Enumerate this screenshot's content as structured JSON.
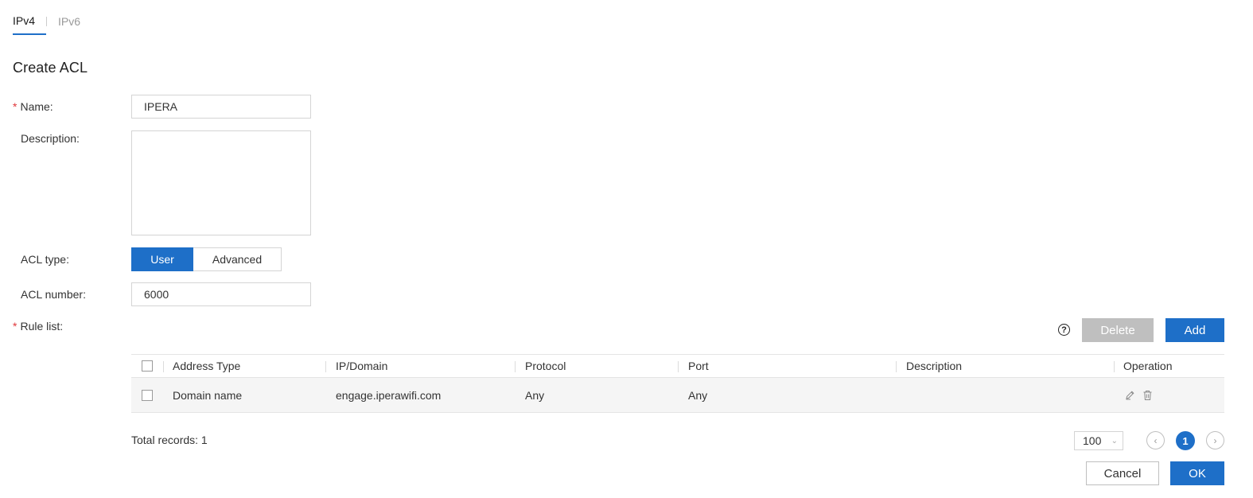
{
  "tabs": [
    {
      "label": "IPv4",
      "active": true
    },
    {
      "label": "IPv6",
      "active": false
    }
  ],
  "page_title": "Create ACL",
  "form": {
    "name_label": "Name:",
    "name_value": "IPERA",
    "description_label": "Description:",
    "description_value": "",
    "acl_type_label": "ACL type:",
    "acl_type_options": [
      "User",
      "Advanced"
    ],
    "acl_type_selected": "User",
    "acl_number_label": "ACL number:",
    "acl_number_value": "6000",
    "rule_list_label": "Rule list:",
    "required_mark": "*"
  },
  "rule_toolbar": {
    "help_icon": "question-circle-icon",
    "delete_label": "Delete",
    "add_label": "Add"
  },
  "table": {
    "columns": [
      "Address Type",
      "IP/Domain",
      "Protocol",
      "Port",
      "Description",
      "Operation"
    ],
    "rows": [
      {
        "address_type": "Domain name",
        "ip_domain": "engage.iperawifi.com",
        "protocol": "Any",
        "port": "Any",
        "description": "",
        "operations": [
          "edit-icon",
          "trash-icon"
        ]
      }
    ]
  },
  "footer": {
    "total_records": "Total records: 1",
    "page_size": "100",
    "current_page": "1",
    "cancel_label": "Cancel",
    "ok_label": "OK"
  },
  "colors": {
    "primary": "#1e6fc8",
    "disabled": "#bfbfbf",
    "required": "#e0373b"
  }
}
